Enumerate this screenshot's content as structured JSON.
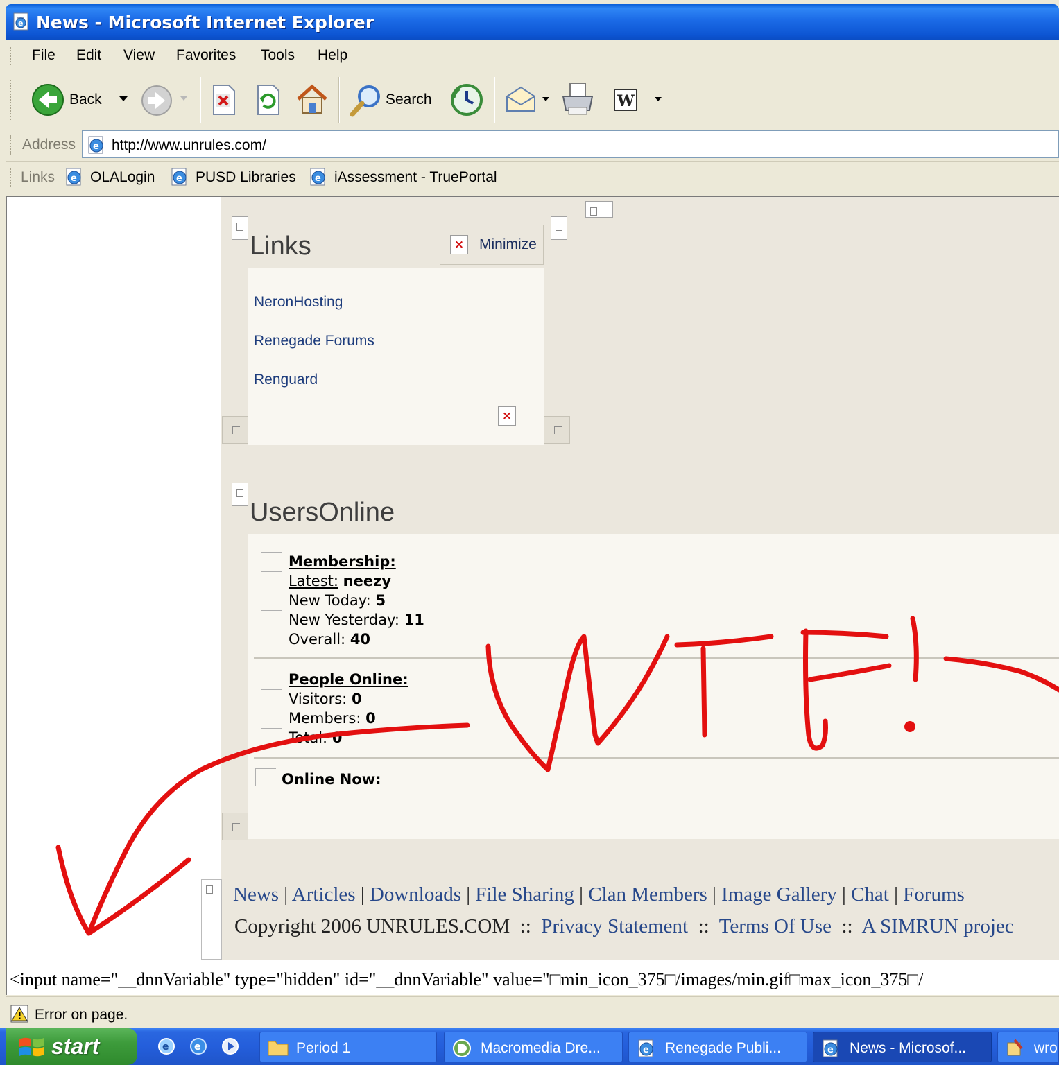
{
  "window": {
    "title": "News - Microsoft Internet Explorer"
  },
  "menu": {
    "items": [
      "File",
      "Edit",
      "View",
      "Favorites",
      "Tools",
      "Help"
    ]
  },
  "toolbar": {
    "back_label": "Back",
    "search_label": "Search"
  },
  "address": {
    "label": "Address",
    "url": "http://www.unrules.com/"
  },
  "links_bar": {
    "label": "Links",
    "items": [
      "OLALogin",
      "PUSD Libraries",
      "iAssessment - TruePortal"
    ]
  },
  "links_module": {
    "title": "Links",
    "minimize_label": "Minimize",
    "items": [
      "NeronHosting",
      "Renegade Forums",
      "Renguard"
    ]
  },
  "users_online": {
    "title": "UsersOnline",
    "membership_heading": "Membership:",
    "latest_label": "Latest:",
    "latest_value": "neezy",
    "new_today_label": "New Today:",
    "new_today_value": "5",
    "new_yesterday_label": "New Yesterday:",
    "new_yesterday_value": "11",
    "overall_label": "Overall:",
    "overall_value": "40",
    "people_heading": "People Online:",
    "visitors_label": "Visitors:",
    "visitors_value": "0",
    "members_label": "Members:",
    "members_value": "0",
    "total_label": "Total:",
    "total_value": "0",
    "online_now_label": "Online Now:"
  },
  "footer": {
    "nav": [
      "News",
      "Articles",
      "Downloads",
      "File Sharing",
      "Clan Members",
      "Image Gallery",
      "Chat",
      "Forums"
    ],
    "copyright": "Copyright 2006 UNRULES.COM",
    "separator": "::",
    "privacy": "Privacy Statement",
    "terms": "Terms Of Use",
    "project": "A SIMRUN projec"
  },
  "source_leak": "<input name=\"__dnnVariable\" type=\"hidden\" id=\"__dnnVariable\" value=\"□min_icon_375□/images/min.gif□max_icon_375□/",
  "status": {
    "text": "Error on page."
  },
  "taskbar": {
    "start_label": "start",
    "tasks": [
      "Period 1",
      "Macromedia Dre...",
      "Renegade Publi...",
      "News - Microsof...",
      "wro"
    ]
  },
  "annotation": {
    "text": "WTF!",
    "color": "#e31010"
  }
}
